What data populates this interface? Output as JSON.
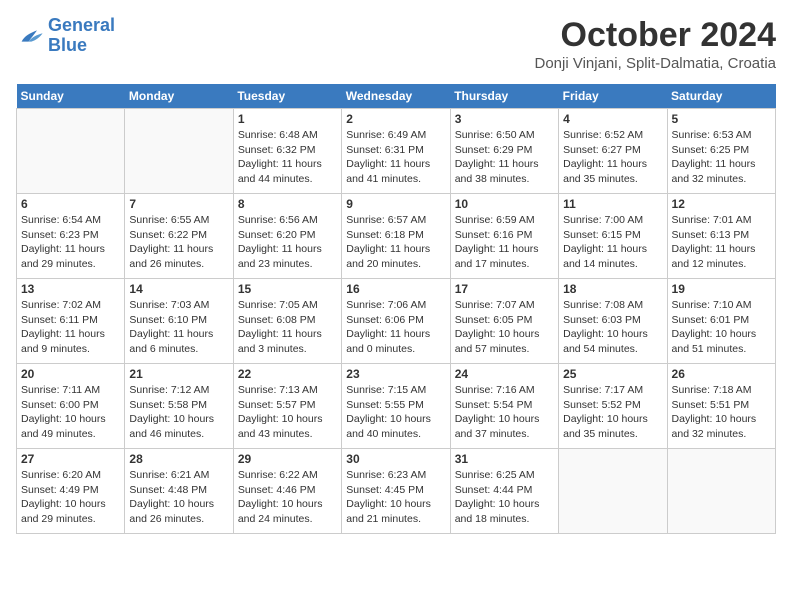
{
  "header": {
    "logo_line1": "General",
    "logo_line2": "Blue",
    "month": "October 2024",
    "location": "Donji Vinjani, Split-Dalmatia, Croatia"
  },
  "days_of_week": [
    "Sunday",
    "Monday",
    "Tuesday",
    "Wednesday",
    "Thursday",
    "Friday",
    "Saturday"
  ],
  "weeks": [
    [
      {
        "day": "",
        "sunrise": "",
        "sunset": "",
        "daylight": ""
      },
      {
        "day": "",
        "sunrise": "",
        "sunset": "",
        "daylight": ""
      },
      {
        "day": "1",
        "sunrise": "Sunrise: 6:48 AM",
        "sunset": "Sunset: 6:32 PM",
        "daylight": "Daylight: 11 hours and 44 minutes."
      },
      {
        "day": "2",
        "sunrise": "Sunrise: 6:49 AM",
        "sunset": "Sunset: 6:31 PM",
        "daylight": "Daylight: 11 hours and 41 minutes."
      },
      {
        "day": "3",
        "sunrise": "Sunrise: 6:50 AM",
        "sunset": "Sunset: 6:29 PM",
        "daylight": "Daylight: 11 hours and 38 minutes."
      },
      {
        "day": "4",
        "sunrise": "Sunrise: 6:52 AM",
        "sunset": "Sunset: 6:27 PM",
        "daylight": "Daylight: 11 hours and 35 minutes."
      },
      {
        "day": "5",
        "sunrise": "Sunrise: 6:53 AM",
        "sunset": "Sunset: 6:25 PM",
        "daylight": "Daylight: 11 hours and 32 minutes."
      }
    ],
    [
      {
        "day": "6",
        "sunrise": "Sunrise: 6:54 AM",
        "sunset": "Sunset: 6:23 PM",
        "daylight": "Daylight: 11 hours and 29 minutes."
      },
      {
        "day": "7",
        "sunrise": "Sunrise: 6:55 AM",
        "sunset": "Sunset: 6:22 PM",
        "daylight": "Daylight: 11 hours and 26 minutes."
      },
      {
        "day": "8",
        "sunrise": "Sunrise: 6:56 AM",
        "sunset": "Sunset: 6:20 PM",
        "daylight": "Daylight: 11 hours and 23 minutes."
      },
      {
        "day": "9",
        "sunrise": "Sunrise: 6:57 AM",
        "sunset": "Sunset: 6:18 PM",
        "daylight": "Daylight: 11 hours and 20 minutes."
      },
      {
        "day": "10",
        "sunrise": "Sunrise: 6:59 AM",
        "sunset": "Sunset: 6:16 PM",
        "daylight": "Daylight: 11 hours and 17 minutes."
      },
      {
        "day": "11",
        "sunrise": "Sunrise: 7:00 AM",
        "sunset": "Sunset: 6:15 PM",
        "daylight": "Daylight: 11 hours and 14 minutes."
      },
      {
        "day": "12",
        "sunrise": "Sunrise: 7:01 AM",
        "sunset": "Sunset: 6:13 PM",
        "daylight": "Daylight: 11 hours and 12 minutes."
      }
    ],
    [
      {
        "day": "13",
        "sunrise": "Sunrise: 7:02 AM",
        "sunset": "Sunset: 6:11 PM",
        "daylight": "Daylight: 11 hours and 9 minutes."
      },
      {
        "day": "14",
        "sunrise": "Sunrise: 7:03 AM",
        "sunset": "Sunset: 6:10 PM",
        "daylight": "Daylight: 11 hours and 6 minutes."
      },
      {
        "day": "15",
        "sunrise": "Sunrise: 7:05 AM",
        "sunset": "Sunset: 6:08 PM",
        "daylight": "Daylight: 11 hours and 3 minutes."
      },
      {
        "day": "16",
        "sunrise": "Sunrise: 7:06 AM",
        "sunset": "Sunset: 6:06 PM",
        "daylight": "Daylight: 11 hours and 0 minutes."
      },
      {
        "day": "17",
        "sunrise": "Sunrise: 7:07 AM",
        "sunset": "Sunset: 6:05 PM",
        "daylight": "Daylight: 10 hours and 57 minutes."
      },
      {
        "day": "18",
        "sunrise": "Sunrise: 7:08 AM",
        "sunset": "Sunset: 6:03 PM",
        "daylight": "Daylight: 10 hours and 54 minutes."
      },
      {
        "day": "19",
        "sunrise": "Sunrise: 7:10 AM",
        "sunset": "Sunset: 6:01 PM",
        "daylight": "Daylight: 10 hours and 51 minutes."
      }
    ],
    [
      {
        "day": "20",
        "sunrise": "Sunrise: 7:11 AM",
        "sunset": "Sunset: 6:00 PM",
        "daylight": "Daylight: 10 hours and 49 minutes."
      },
      {
        "day": "21",
        "sunrise": "Sunrise: 7:12 AM",
        "sunset": "Sunset: 5:58 PM",
        "daylight": "Daylight: 10 hours and 46 minutes."
      },
      {
        "day": "22",
        "sunrise": "Sunrise: 7:13 AM",
        "sunset": "Sunset: 5:57 PM",
        "daylight": "Daylight: 10 hours and 43 minutes."
      },
      {
        "day": "23",
        "sunrise": "Sunrise: 7:15 AM",
        "sunset": "Sunset: 5:55 PM",
        "daylight": "Daylight: 10 hours and 40 minutes."
      },
      {
        "day": "24",
        "sunrise": "Sunrise: 7:16 AM",
        "sunset": "Sunset: 5:54 PM",
        "daylight": "Daylight: 10 hours and 37 minutes."
      },
      {
        "day": "25",
        "sunrise": "Sunrise: 7:17 AM",
        "sunset": "Sunset: 5:52 PM",
        "daylight": "Daylight: 10 hours and 35 minutes."
      },
      {
        "day": "26",
        "sunrise": "Sunrise: 7:18 AM",
        "sunset": "Sunset: 5:51 PM",
        "daylight": "Daylight: 10 hours and 32 minutes."
      }
    ],
    [
      {
        "day": "27",
        "sunrise": "Sunrise: 6:20 AM",
        "sunset": "Sunset: 4:49 PM",
        "daylight": "Daylight: 10 hours and 29 minutes."
      },
      {
        "day": "28",
        "sunrise": "Sunrise: 6:21 AM",
        "sunset": "Sunset: 4:48 PM",
        "daylight": "Daylight: 10 hours and 26 minutes."
      },
      {
        "day": "29",
        "sunrise": "Sunrise: 6:22 AM",
        "sunset": "Sunset: 4:46 PM",
        "daylight": "Daylight: 10 hours and 24 minutes."
      },
      {
        "day": "30",
        "sunrise": "Sunrise: 6:23 AM",
        "sunset": "Sunset: 4:45 PM",
        "daylight": "Daylight: 10 hours and 21 minutes."
      },
      {
        "day": "31",
        "sunrise": "Sunrise: 6:25 AM",
        "sunset": "Sunset: 4:44 PM",
        "daylight": "Daylight: 10 hours and 18 minutes."
      },
      {
        "day": "",
        "sunrise": "",
        "sunset": "",
        "daylight": ""
      },
      {
        "day": "",
        "sunrise": "",
        "sunset": "",
        "daylight": ""
      }
    ]
  ]
}
